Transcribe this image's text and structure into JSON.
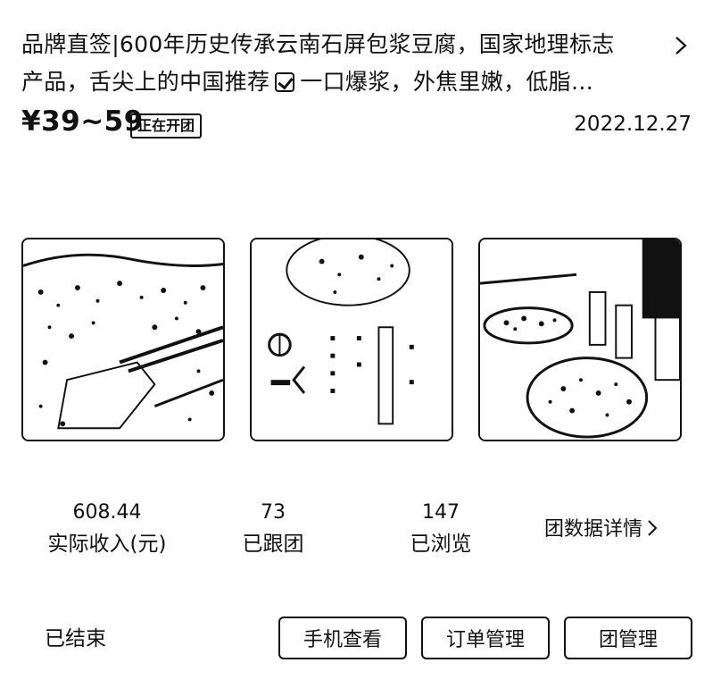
{
  "product": {
    "title_line1": "品牌直签|600年历史传承云南石屏包浆豆腐，国家地理标志",
    "title_line2_a": "产品，舌尖上的中国推荐",
    "title_line2_b": "一口爆浆，外焦里嫩，低脂…",
    "price": "¥39~59",
    "badge": "正在开团",
    "date": "2022.12.27"
  },
  "icons": {
    "title_arrow": "chevron-right-icon",
    "check": "checkbox-checked-icon",
    "detail_arrow": "chevron-right-icon"
  },
  "stats": [
    {
      "value": "608.44",
      "label": "实际收入(元)"
    },
    {
      "value": "73",
      "label": "已跟团"
    },
    {
      "value": "147",
      "label": "已浏览"
    }
  ],
  "detail_link": "团数据详情",
  "footer": {
    "status": "已结束",
    "buttons": [
      "手机查看",
      "订单管理",
      "团管理"
    ]
  }
}
